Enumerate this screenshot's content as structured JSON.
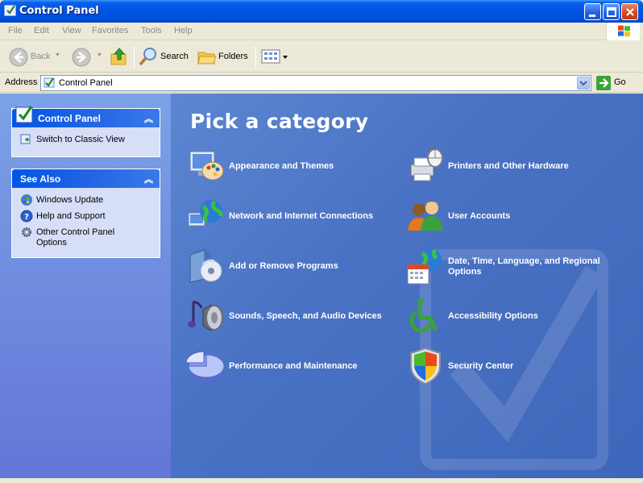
{
  "window": {
    "title": "Control Panel"
  },
  "menubar": {
    "items": [
      "File",
      "Edit",
      "View",
      "Favorites",
      "Tools",
      "Help"
    ]
  },
  "toolbar": {
    "back_label": "Back",
    "search_label": "Search",
    "folders_label": "Folders"
  },
  "address": {
    "label": "Address",
    "value": "Control Panel",
    "go_label": "Go"
  },
  "left_panels": {
    "control_panel": {
      "title": "Control Panel",
      "links": [
        "Switch to Classic View"
      ]
    },
    "see_also": {
      "title": "See Also",
      "links": [
        "Windows Update",
        "Help and Support",
        "Other Control Panel Options"
      ]
    }
  },
  "main": {
    "heading": "Pick a category",
    "categories": [
      {
        "label": "Appearance and Themes",
        "icon": "appearance-themes-icon"
      },
      {
        "label": "Printers and Other Hardware",
        "icon": "printer-hardware-icon"
      },
      {
        "label": "Network and Internet Connections",
        "icon": "network-globe-icon"
      },
      {
        "label": "User Accounts",
        "icon": "user-accounts-icon"
      },
      {
        "label": "Add or Remove Programs",
        "icon": "add-remove-programs-icon"
      },
      {
        "label": "Date, Time, Language, and Regional Options",
        "icon": "date-time-language-icon"
      },
      {
        "label": "Sounds, Speech, and Audio Devices",
        "icon": "sounds-speaker-icon"
      },
      {
        "label": "Accessibility Options",
        "icon": "accessibility-icon"
      },
      {
        "label": "Performance and Maintenance",
        "icon": "performance-pie-icon"
      },
      {
        "label": "Security Center",
        "icon": "security-shield-icon"
      }
    ]
  },
  "colors": {
    "title_bar": "#0054e3",
    "left_pane": "#7ba2e7",
    "right_pane": "#4a72c4",
    "panel_link_bg": "#d6dff7",
    "panel_title": "#215dc6"
  }
}
